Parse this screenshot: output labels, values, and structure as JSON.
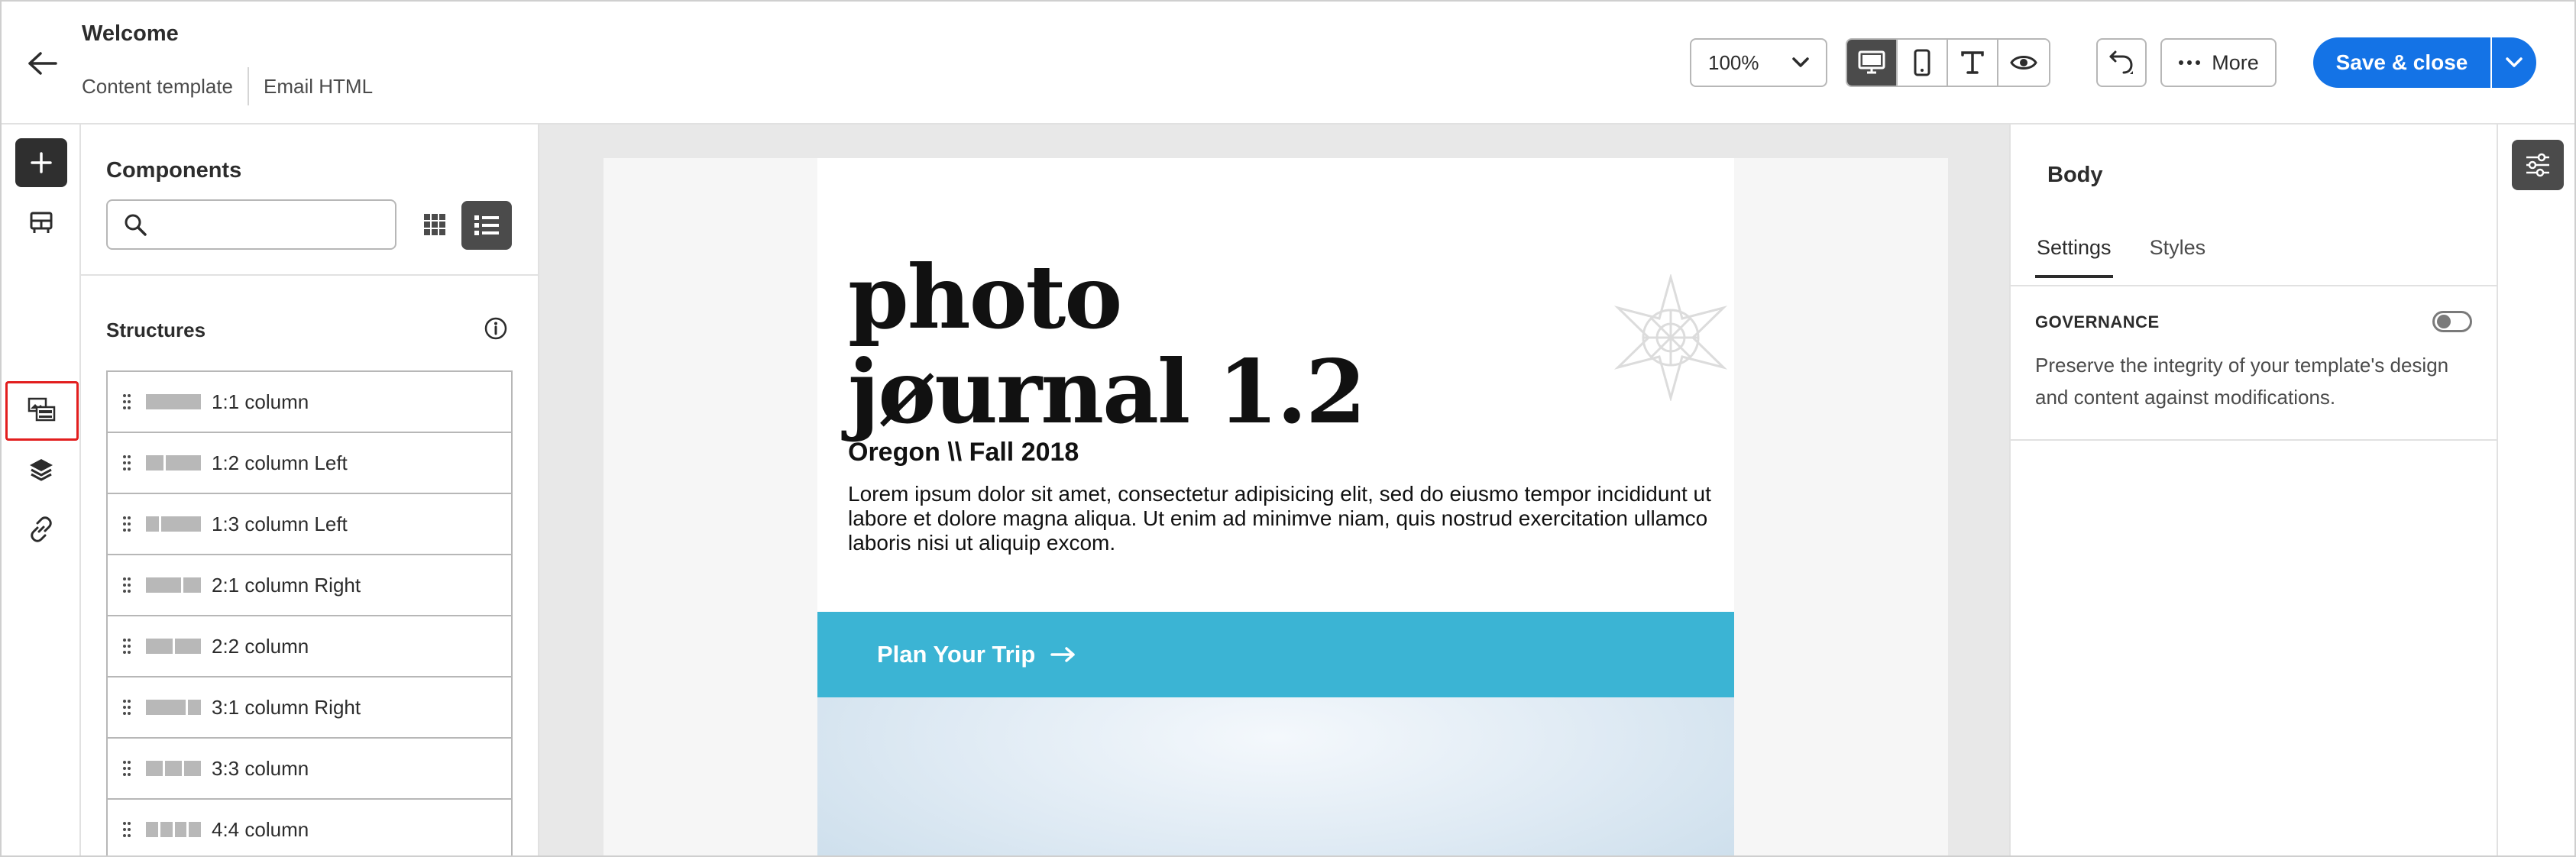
{
  "header": {
    "title": "Welcome",
    "breadcrumb_type": "Content template",
    "breadcrumb_format": "Email HTML",
    "zoom_value": "100%",
    "more_label": "More",
    "save_label": "Save & close"
  },
  "view_modes": [
    "desktop-icon",
    "mobile-icon",
    "text-icon",
    "preview-icon"
  ],
  "left_rail": {
    "items": [
      "add-icon",
      "structures-icon",
      "components-icon",
      "layers-icon",
      "link-icon"
    ],
    "highlighted_item": "components-icon"
  },
  "components_panel": {
    "title": "Components",
    "search_placeholder": "",
    "structures_label": "Structures",
    "structures": [
      {
        "label": "1:1 column",
        "parts": [
          1
        ]
      },
      {
        "label": "1:2 column Left",
        "parts": [
          1,
          2
        ]
      },
      {
        "label": "1:3 column Left",
        "parts": [
          1,
          3
        ]
      },
      {
        "label": "2:1 column Right",
        "parts": [
          2,
          1
        ]
      },
      {
        "label": "2:2 column",
        "parts": [
          1,
          1
        ]
      },
      {
        "label": "3:1 column Right",
        "parts": [
          3,
          1
        ]
      },
      {
        "label": "3:3 column",
        "parts": [
          1,
          1,
          1
        ]
      },
      {
        "label": "4:4 column",
        "parts": [
          1,
          1,
          1,
          1
        ]
      }
    ]
  },
  "email": {
    "title_line1": "photo",
    "title_line2": "jøurnal 1.2",
    "subtitle": "Oregon \\\\ Fall 2018",
    "body": "Lorem ipsum dolor sit amet, consectetur adipisicing elit, sed do eiusmo tempor incididunt ut labore et dolore magna aliqua. Ut enim ad minimve niam, quis nostrud exercitation ullamco laboris nisi ut aliquip excom.",
    "cta_label": "Plan Your Trip",
    "cta_color": "#3bb4d4"
  },
  "properties_panel": {
    "title": "Body",
    "tabs": [
      "Settings",
      "Styles"
    ],
    "active_tab": "Settings",
    "governance_label": "GOVERNANCE",
    "governance_enabled": false,
    "governance_description": "Preserve the integrity of your template's design and content against modifications."
  },
  "colors": {
    "accent": "#1473e6",
    "annotation": "#e21e1e"
  }
}
